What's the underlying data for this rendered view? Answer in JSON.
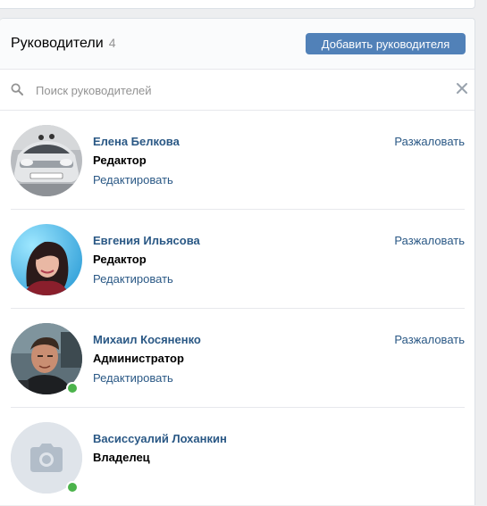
{
  "header": {
    "title": "Руководители",
    "count": "4",
    "add_button": "Добавить руководителя"
  },
  "search": {
    "placeholder": "Поиск руководителей"
  },
  "managers": [
    {
      "name": "Елена Белкова",
      "role": "Редактор",
      "edit": "Редактировать",
      "demote": "Разжаловать",
      "online": false,
      "avatar": "car-photo"
    },
    {
      "name": "Евгения Ильясова",
      "role": "Редактор",
      "edit": "Редактировать",
      "demote": "Разжаловать",
      "online": false,
      "avatar": "woman-photo"
    },
    {
      "name": "Михаил Косяненко",
      "role": "Администратор",
      "edit": "Редактировать",
      "demote": "Разжаловать",
      "online": true,
      "avatar": "man-photo"
    },
    {
      "name": "Васиссуалий Лоханкин",
      "role": "Владелец",
      "online": true,
      "avatar": "camera-placeholder"
    }
  ],
  "colors": {
    "accent": "#5181b8",
    "link": "#2a5885",
    "online": "#4bb34b",
    "background": "#edeef0"
  }
}
